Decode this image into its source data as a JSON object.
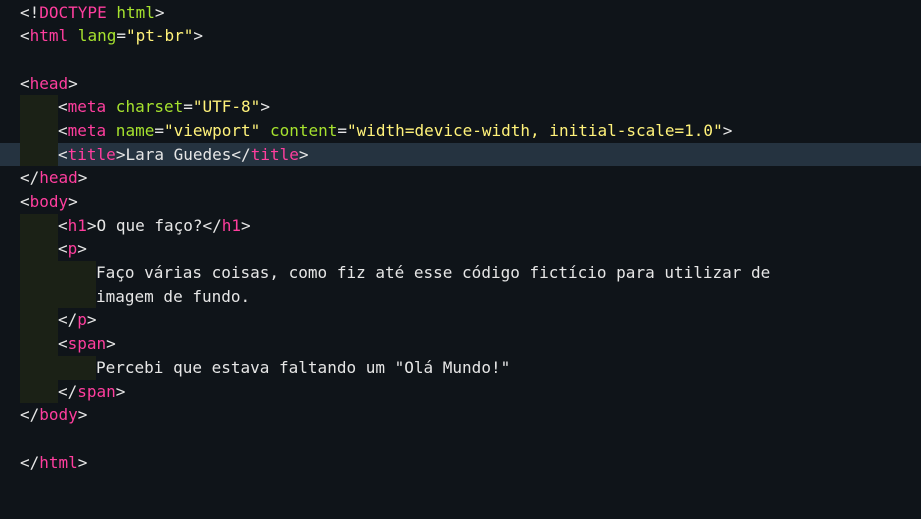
{
  "colors": {
    "background": "#0f1419",
    "current_line": "#253340",
    "indent_guide": "#1b2116",
    "tag": "#ff3e9e",
    "attribute": "#a6e22e",
    "string": "#fff27a",
    "text": "#e6e6e6"
  },
  "lines": [
    {
      "indent": 0,
      "tokens": [
        {
          "t": "<!",
          "k": "punc"
        },
        {
          "t": "DOCTYPE",
          "k": "tag"
        },
        {
          "t": " html",
          "k": "attr"
        },
        {
          "t": ">",
          "k": "punc"
        }
      ]
    },
    {
      "indent": 0,
      "tokens": [
        {
          "t": "<",
          "k": "punc"
        },
        {
          "t": "html",
          "k": "tag"
        },
        {
          "t": " lang",
          "k": "attr"
        },
        {
          "t": "=",
          "k": "punc"
        },
        {
          "t": "\"pt-br\"",
          "k": "str"
        },
        {
          "t": ">",
          "k": "punc"
        }
      ]
    },
    {
      "indent": 0,
      "tokens": []
    },
    {
      "indent": 0,
      "tokens": [
        {
          "t": "<",
          "k": "punc"
        },
        {
          "t": "head",
          "k": "tag"
        },
        {
          "t": ">",
          "k": "punc"
        }
      ]
    },
    {
      "indent": 1,
      "tokens": [
        {
          "t": "<",
          "k": "punc"
        },
        {
          "t": "meta",
          "k": "tag"
        },
        {
          "t": " charset",
          "k": "attr"
        },
        {
          "t": "=",
          "k": "punc"
        },
        {
          "t": "\"UTF-8\"",
          "k": "str"
        },
        {
          "t": ">",
          "k": "punc"
        }
      ]
    },
    {
      "indent": 1,
      "tokens": [
        {
          "t": "<",
          "k": "punc"
        },
        {
          "t": "meta",
          "k": "tag"
        },
        {
          "t": " name",
          "k": "attr"
        },
        {
          "t": "=",
          "k": "punc"
        },
        {
          "t": "\"viewport\"",
          "k": "str"
        },
        {
          "t": " content",
          "k": "attr"
        },
        {
          "t": "=",
          "k": "punc"
        },
        {
          "t": "\"width=device-width, initial-scale=1.0\"",
          "k": "str"
        },
        {
          "t": ">",
          "k": "punc"
        }
      ]
    },
    {
      "indent": 1,
      "current": true,
      "tokens": [
        {
          "t": "<",
          "k": "punc"
        },
        {
          "t": "title",
          "k": "tag"
        },
        {
          "t": ">",
          "k": "punc"
        },
        {
          "t": "Lara Guedes",
          "k": "text"
        },
        {
          "t": "</",
          "k": "punc"
        },
        {
          "t": "title",
          "k": "tag"
        },
        {
          "t": ">",
          "k": "punc"
        }
      ]
    },
    {
      "indent": 0,
      "tokens": [
        {
          "t": "</",
          "k": "punc"
        },
        {
          "t": "head",
          "k": "tag"
        },
        {
          "t": ">",
          "k": "punc"
        }
      ]
    },
    {
      "indent": 0,
      "tokens": [
        {
          "t": "<",
          "k": "punc"
        },
        {
          "t": "body",
          "k": "tag"
        },
        {
          "t": ">",
          "k": "punc"
        }
      ]
    },
    {
      "indent": 1,
      "tokens": [
        {
          "t": "<",
          "k": "punc"
        },
        {
          "t": "h1",
          "k": "tag"
        },
        {
          "t": ">",
          "k": "punc"
        },
        {
          "t": "O que faço?",
          "k": "text"
        },
        {
          "t": "</",
          "k": "punc"
        },
        {
          "t": "h1",
          "k": "tag"
        },
        {
          "t": ">",
          "k": "punc"
        }
      ]
    },
    {
      "indent": 1,
      "tokens": [
        {
          "t": "<",
          "k": "punc"
        },
        {
          "t": "p",
          "k": "tag"
        },
        {
          "t": ">",
          "k": "punc"
        }
      ]
    },
    {
      "indent": 2,
      "tokens": [
        {
          "t": "Faço várias coisas, como fiz até esse código fictício para utilizar de",
          "k": "text"
        }
      ]
    },
    {
      "indent": 2,
      "tokens": [
        {
          "t": "imagem de fundo.",
          "k": "text"
        }
      ]
    },
    {
      "indent": 1,
      "tokens": [
        {
          "t": "</",
          "k": "punc"
        },
        {
          "t": "p",
          "k": "tag"
        },
        {
          "t": ">",
          "k": "punc"
        }
      ]
    },
    {
      "indent": 1,
      "tokens": [
        {
          "t": "<",
          "k": "punc"
        },
        {
          "t": "span",
          "k": "tag"
        },
        {
          "t": ">",
          "k": "punc"
        }
      ]
    },
    {
      "indent": 2,
      "tokens": [
        {
          "t": "Percebi que estava faltando um \"Olá Mundo!\"",
          "k": "text"
        }
      ]
    },
    {
      "indent": 1,
      "tokens": [
        {
          "t": "</",
          "k": "punc"
        },
        {
          "t": "span",
          "k": "tag"
        },
        {
          "t": ">",
          "k": "punc"
        }
      ]
    },
    {
      "indent": 0,
      "tokens": [
        {
          "t": "</",
          "k": "punc"
        },
        {
          "t": "body",
          "k": "tag"
        },
        {
          "t": ">",
          "k": "punc"
        }
      ]
    },
    {
      "indent": 0,
      "tokens": []
    },
    {
      "indent": 0,
      "tokens": [
        {
          "t": "</",
          "k": "punc"
        },
        {
          "t": "html",
          "k": "tag"
        },
        {
          "t": ">",
          "k": "punc"
        }
      ]
    }
  ]
}
